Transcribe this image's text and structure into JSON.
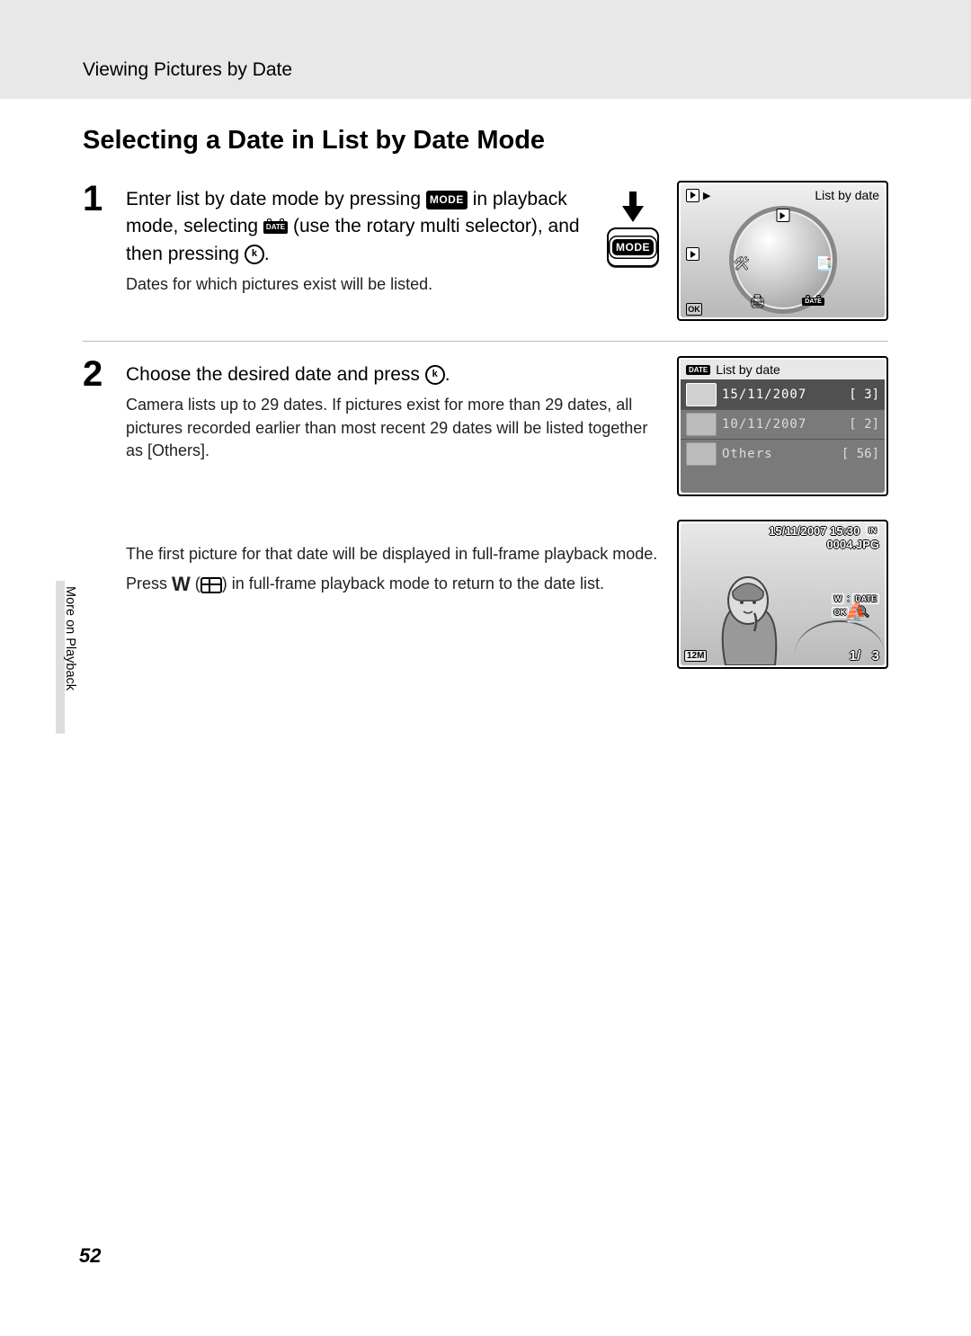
{
  "header": {
    "breadcrumb": "Viewing Pictures by Date"
  },
  "title": "Selecting a Date in List by Date Mode",
  "step1": {
    "num": "1",
    "lead_a": "Enter list by date mode by pressing ",
    "lead_b": " in playback mode, selecting ",
    "lead_c": " (use the rotary multi selector), and then pressing ",
    "lead_d": ".",
    "sub": "Dates for which pictures exist will be listed.",
    "mode_label": "MODE",
    "date_label": "DATE",
    "ok_label": "k",
    "screen_title": "List by date"
  },
  "step2": {
    "num": "2",
    "lead_a": "Choose the desired date and press ",
    "lead_b": ".",
    "ok_label": "k",
    "sub1": "Camera lists up to 29 dates. If pictures exist for more than 29 dates, all pictures recorded earlier than most recent 29 dates will be listed together as [Others].",
    "sub2": "The first picture for that date will be displayed in full-frame playback mode.",
    "sub3_a": "Press ",
    "sub3_b": " (",
    "sub3_c": ") in full-frame playback mode to return to the date list.",
    "w_label": "W",
    "list_title": "List by date",
    "rows": [
      {
        "date": "15/11/2007",
        "count": "3"
      },
      {
        "date": "10/11/2007",
        "count": "2"
      },
      {
        "date": "Others",
        "count": "56"
      }
    ]
  },
  "playback": {
    "datetime": "15/11/2007 15:30",
    "filename": "0004.JPG",
    "in_label": "IN",
    "size_badge": "12M",
    "counter_cur": "1/",
    "counter_tot": "3",
    "hint_w": "W",
    "hint_date": "DATE",
    "hint_ok": "OK",
    "hint_zoom": "🔍"
  },
  "sidebar_label": "More on Playback",
  "page_number": "52"
}
